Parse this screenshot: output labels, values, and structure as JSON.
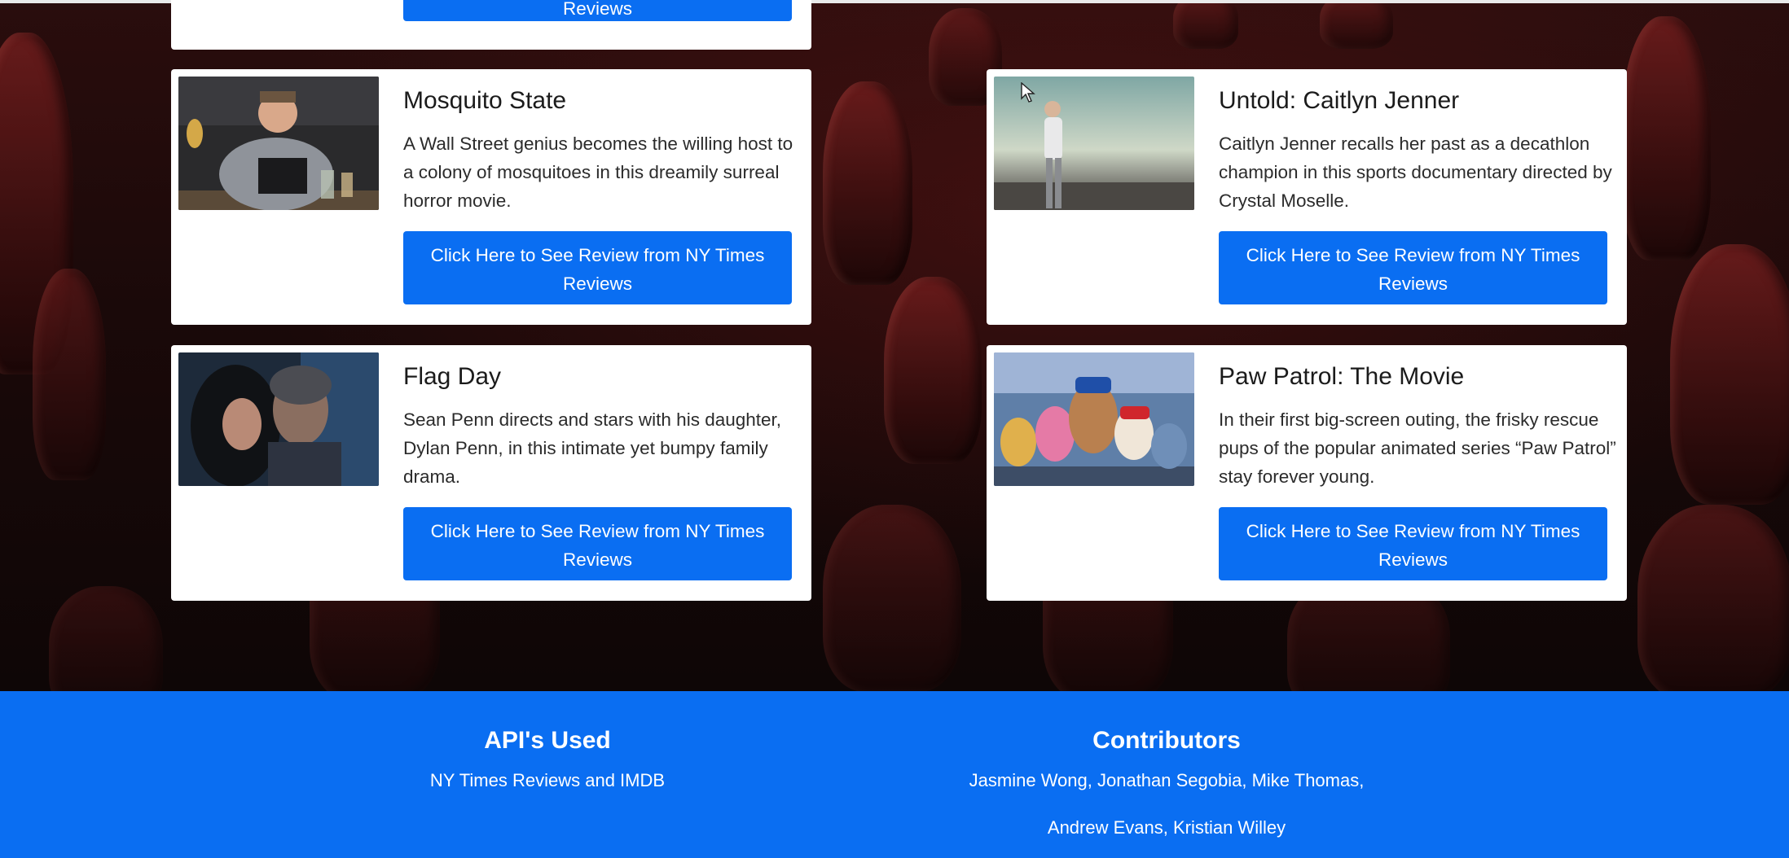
{
  "movies": [
    {
      "title": "Mosquito State",
      "description": "A Wall Street genius becomes the willing host to a colony of mosquitoes in this dreamily surreal horror movie.",
      "button_label": "Click Here to See Review from NY Times Reviews"
    },
    {
      "title": "Untold: Caitlyn Jenner",
      "description": "Caitlyn Jenner recalls her past as a decathlon champion in this sports documentary directed by Crystal Moselle.",
      "button_label": "Click Here to See Review from NY Times Reviews"
    },
    {
      "title": "Flag Day",
      "description": "Sean Penn directs and stars with his daughter, Dylan Penn, in this intimate yet bumpy family drama.",
      "button_label": "Click Here to See Review from NY Times Reviews"
    },
    {
      "title": "Paw Patrol: The Movie",
      "description": "In their first big-screen outing, the frisky rescue pups of the popular animated series “Paw Patrol” stay forever young.",
      "button_label": "Click Here to See Review from NY Times Reviews"
    }
  ],
  "partial_card": {
    "button_label_tail": "Reviews"
  },
  "footer": {
    "apis_heading": "API's Used",
    "apis_text": "NY Times Reviews and IMDB",
    "contributors_heading": "Contributors",
    "contributors_line1": "Jasmine Wong, Jonathan Segobia, Mike Thomas,",
    "contributors_line2": "Andrew Evans, Kristian Willey"
  },
  "colors": {
    "primary": "#0a6ef2",
    "card_bg": "#ffffff",
    "theater_red": "#6e1d1d"
  }
}
